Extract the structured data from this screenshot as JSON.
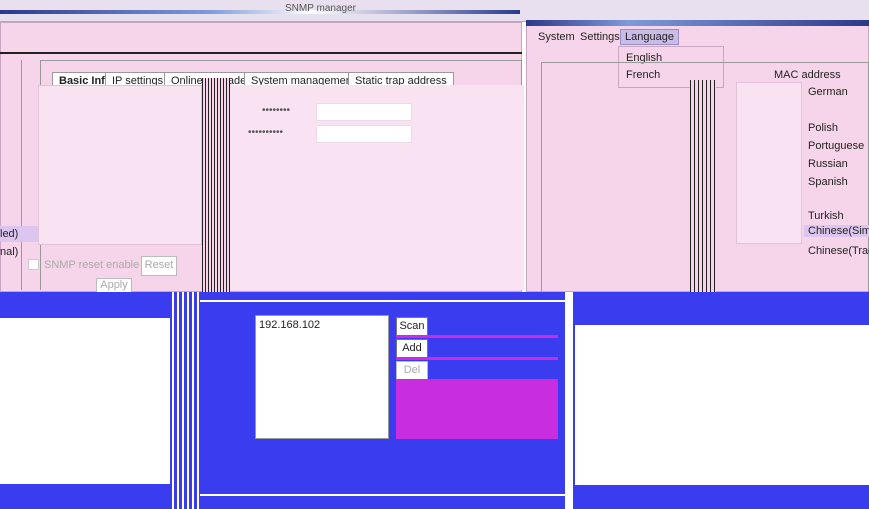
{
  "window": {
    "title": "SNMP manager"
  },
  "menu": {
    "items": [
      "System",
      "Settings"
    ],
    "open_item": "Language"
  },
  "language_menu": {
    "options": [
      "English",
      "French"
    ]
  },
  "language_list": {
    "items": [
      "German",
      "Polish",
      "Portuguese",
      "Russian",
      "Spanish",
      "Turkish"
    ],
    "selected": "Chinese(Simp",
    "last": "Chinese(Tradi"
  },
  "tabs": [
    "Basic Info",
    "IP settings",
    "Online upgrade",
    "System management",
    "Static trap address"
  ],
  "table_header": {
    "mac_address": "MAC address"
  },
  "left_panel": {
    "rows": [
      "led)",
      "nal)"
    ],
    "snmp_reset_label": "SNMP reset enable",
    "reset_button": "Reset",
    "apply_button": "Apply"
  },
  "ip_panel": {
    "ip_entry": "192.168.102",
    "scan_button": "Scan",
    "add_button": "Add",
    "del_button": "Del"
  },
  "colors": {
    "pink": "#f6d5ea",
    "blue": "#3a3cf0",
    "purple": "#c82ee0",
    "lilac": "#dcc6f0"
  }
}
